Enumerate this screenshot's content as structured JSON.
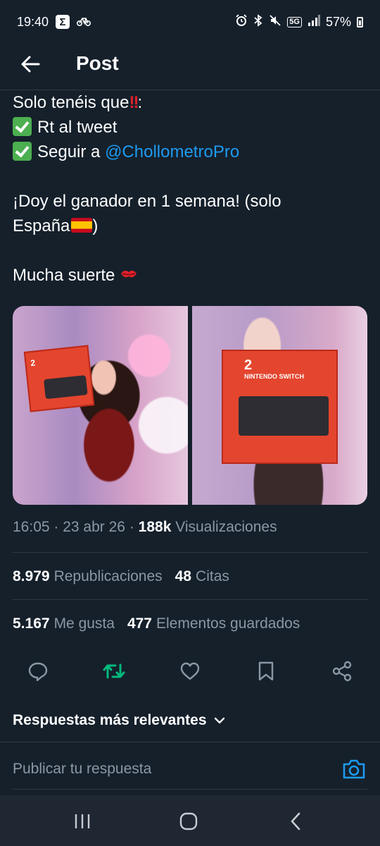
{
  "status_bar": {
    "time": "19:40",
    "sigma": "Σ",
    "network": "5G",
    "battery": "57%"
  },
  "header": {
    "title": "Post"
  },
  "tweet": {
    "line1": "Solo tenéis que",
    "line1_suffix": ":",
    "line2": "Rt al tweet",
    "line3_prefix": "Seguir a ",
    "mention": "@ChollometroPro",
    "line4": "¡Doy el ganador en 1 semana! (solo",
    "line5_prefix": "España",
    "line5_suffix": ")",
    "line6": "Mucha suerte",
    "box_logo_1": "2",
    "box_logo_2": "2",
    "box_logo_2_sub": "NINTENDO SWITCH"
  },
  "meta": {
    "time": "16:05",
    "sep1": " · ",
    "date": "23 abr 26",
    "sep2": " · ",
    "views_count": "188k",
    "views_label": " Visualizaciones"
  },
  "stats": {
    "reposts_count": "8.979",
    "reposts_label": "Republicaciones",
    "quotes_count": "48",
    "quotes_label": "Citas",
    "likes_count": "5.167",
    "likes_label": "Me gusta",
    "bookmarks_count": "477",
    "bookmarks_label": "Elementos guardados"
  },
  "actions": {
    "icons": [
      "reply-icon",
      "repost-icon",
      "like-icon",
      "bookmark-icon",
      "share-icon"
    ],
    "repost_active_color": "#00ba7c"
  },
  "replies": {
    "sort_label": "Respuestas más relevantes",
    "input_placeholder": "Publicar tu respuesta"
  },
  "colors": {
    "background": "#15202b",
    "accent": "#1d9bf0",
    "muted": "#8b98a5",
    "divider": "#2f3b47"
  }
}
